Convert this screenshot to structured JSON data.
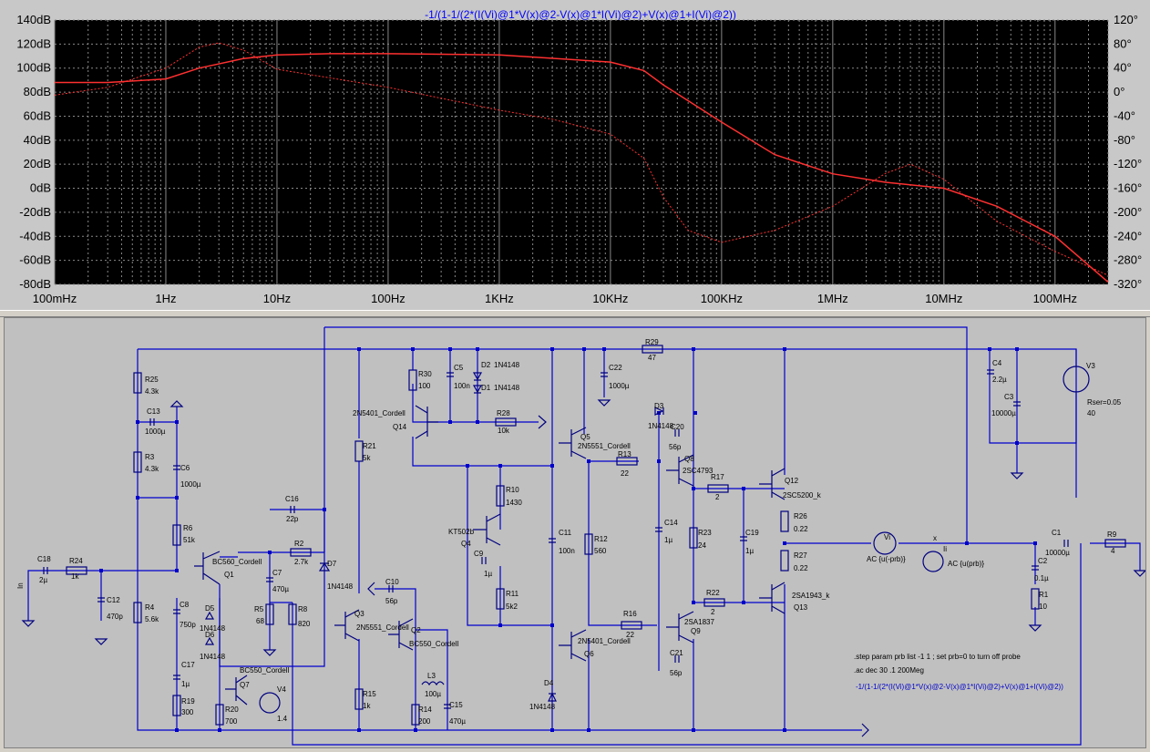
{
  "plot": {
    "expression": "-1/(1-1/(2*(I(Vi)@1*V(x)@2-V(x)@1*I(Vi)@2)+V(x)@1+I(Vi)@2))",
    "left_ticks": [
      "140dB",
      "120dB",
      "100dB",
      "80dB",
      "60dB",
      "40dB",
      "20dB",
      "0dB",
      "-20dB",
      "-40dB",
      "-60dB",
      "-80dB"
    ],
    "right_ticks": [
      "120°",
      "80°",
      "40°",
      "0°",
      "-40°",
      "-80°",
      "-120°",
      "-160°",
      "-200°",
      "-240°",
      "-280°",
      "-320°"
    ],
    "x_ticks": [
      "100mHz",
      "1Hz",
      "10Hz",
      "100Hz",
      "1KHz",
      "10KHz",
      "100KHz",
      "1MHz",
      "10MHz",
      "100MHz"
    ],
    "colors": {
      "background": "#000000",
      "grid": "#888888",
      "trace": "#ff3030",
      "title": "#0000ff",
      "text": "#000000"
    }
  },
  "chart_data": {
    "type": "line",
    "x_scale": "log",
    "xlim": [
      0.1,
      300000000
    ],
    "ylim": [
      -80,
      140
    ],
    "y2lim": [
      -320,
      120
    ],
    "grid": true,
    "series": [
      {
        "axis": "left",
        "style": "solid",
        "x": [
          0.1,
          0.3,
          1,
          2,
          5,
          10,
          30,
          100,
          1000,
          10000,
          20000,
          30000,
          100000,
          300000,
          1000000,
          3000000,
          10000000,
          30000000,
          100000000,
          300000000
        ],
        "y": [
          88,
          88,
          91,
          100,
          108,
          111,
          112,
          112,
          111,
          105,
          98,
          86,
          55,
          28,
          12,
          5,
          0,
          -15,
          -40,
          -78
        ]
      },
      {
        "axis": "right",
        "style": "dotted",
        "x": [
          0.1,
          0.3,
          1,
          2,
          3,
          5,
          10,
          100,
          1000,
          3000,
          10000,
          20000,
          30000,
          50000,
          100000,
          300000,
          1000000,
          3000000,
          5000000,
          10000000,
          30000000,
          100000000,
          300000000
        ],
        "y": [
          -5,
          8,
          40,
          75,
          82,
          70,
          38,
          8,
          -30,
          -45,
          -70,
          -110,
          -175,
          -230,
          -250,
          -230,
          -190,
          -135,
          -120,
          -145,
          -215,
          -265,
          -305
        ]
      }
    ]
  },
  "schematic": {
    "labels": {
      "R25": "R25",
      "R25v": "4.3k",
      "C13": "C13",
      "C13v": "1000µ",
      "R3": "R3",
      "R3v": "4.3k",
      "C6": "C6",
      "C6v": "1000µ",
      "R6": "R6",
      "R6v": "51k",
      "C18": "C18",
      "C18v": "2µ",
      "R24": "R24",
      "R24v": "1k",
      "In": "In",
      "C12": "C12",
      "C12v": "470p",
      "R4": "R4",
      "R4v": "5.6k",
      "Q1": "Q1",
      "Q1t": "BC560_Cordell",
      "C8": "C8",
      "C8v": "750p",
      "D5": "D5",
      "D5t": "1N4148",
      "D6": "D6",
      "D6t": "1N4148",
      "C17": "C17",
      "C17v": "1µ",
      "R19": "R19",
      "R19v": "300",
      "Q7": "Q7",
      "Q7t": "BC550_Cordell",
      "R20": "R20",
      "R20v": "700",
      "V4": "V4",
      "V4v": "1.4",
      "R5": "R5",
      "R5v": "68",
      "R8": "R8",
      "R8v": "820",
      "C7": "C7",
      "C7v": "470µ",
      "R2": "R2",
      "R2v": "2.7k",
      "C16": "C16",
      "C16v": "22p",
      "D7": "D7",
      "D7t": "1N4148",
      "R21": "R21",
      "R21v": "5k",
      "Q3": "Q3",
      "Q3t": "2N5551_Cordell",
      "Q2": "Q2",
      "Q2t": "BC550_Cordell",
      "C10": "C10",
      "C10v": "56p",
      "R15": "R15",
      "R15v": "1k",
      "L3": "L3",
      "L3v": "100µ",
      "R14": "R14",
      "R14v": "200",
      "C15": "C15",
      "C15v": "470µ",
      "R30": "R30",
      "R30v": "100",
      "C5": "C5",
      "C5v": "100n",
      "D2": "D2",
      "D2t": "1N4148",
      "D1": "D1",
      "D1t": "1N4148",
      "Q14": "Q14",
      "Q14t": "2N5401_Cordell",
      "R28": "R28",
      "R28v": "10k",
      "R10": "R10",
      "R10v": "1430",
      "Q4": "Q4",
      "Q4t": "KT502b",
      "C9": "C9",
      "C9v": "1µ",
      "R11": "R11",
      "R11v": "5k2",
      "C11": "C11",
      "C11v": "100n",
      "D4": "D4",
      "D4t": "1N4148",
      "C22": "C22",
      "C22v": "1000µ",
      "R29": "R29",
      "R29v": "47",
      "Q5": "Q5",
      "Q5t": "2N5551_Cordell",
      "R13": "R13",
      "R13v": "22",
      "R12": "R12",
      "R12v": "560",
      "R16": "R16",
      "R16v": "22",
      "Q6": "Q6",
      "Q6t": "2N5401_Cordell",
      "D3": "D3",
      "D3t": "1N4148",
      "C20": "C20",
      "C20v": "56p",
      "Q8": "Q8",
      "Q8t": "2SC4793",
      "C14": "C14",
      "C14v": "1µ",
      "R23": "R23",
      "R23v": "24",
      "R17": "R17",
      "R17v": "2",
      "R22": "R22",
      "R22v": "2",
      "Q9": "Q9",
      "Q9t": "2SA1837",
      "C21": "C21",
      "C21v": "56p",
      "C19": "C19",
      "C19v": "1µ",
      "Q12": "Q12",
      "Q12t": "2SC5200_k",
      "R26": "R26",
      "R26v": "0.22",
      "R27": "R27",
      "R27v": "0.22",
      "Q13": "Q13",
      "Q13t": "2SA1943_k",
      "Vi": "Vi",
      "Viv": "AC {u(-prb)}",
      "x": "x",
      "Ii": "Ii",
      "Iiv": "AC {u(prb)}",
      "C1": "C1",
      "C1v": "10000µ",
      "R9": "R9",
      "R9v": "4",
      "C2": "C2",
      "C2v": "0.1µ",
      "R1": "R1",
      "R1v": "10",
      "C4": "C4",
      "C4v": "2.2µ",
      "C3": "C3",
      "C3v": "10000µ",
      "V3": "V3",
      "V3r": "Rser=0.05",
      "V3v": "40"
    },
    "directives": {
      "step": ".step param prb list -1 1 ; set prb=0 to turn off probe",
      "ac": ".ac dec 30 .1 200Meg",
      "measure": "-1/(1-1/(2*(I(Vi)@1*V(x)@2-V(x)@1*I(Vi)@2)+V(x)@1+I(Vi)@2))"
    }
  }
}
